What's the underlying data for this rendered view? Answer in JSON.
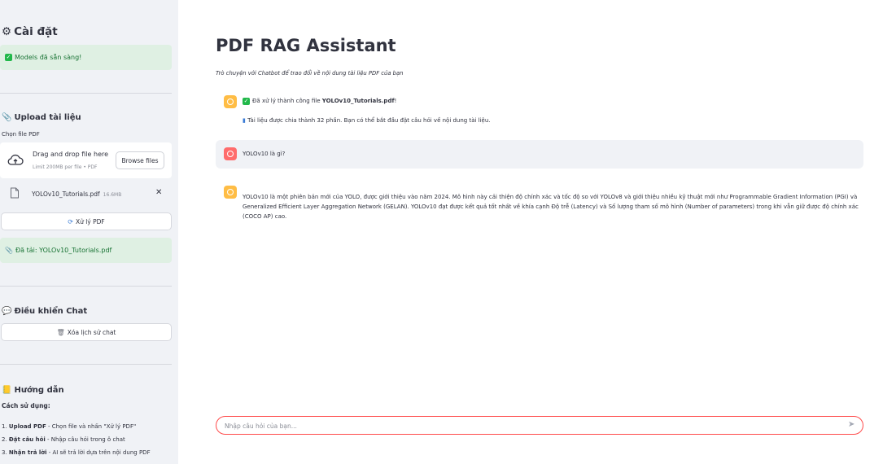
{
  "sidebar": {
    "settings_title": "Cài đặt",
    "models_status": "Models đã sẵn sàng!",
    "upload_title": "Upload tài liệu",
    "file_label": "Chọn file PDF",
    "dropzone_title": "Drag and drop file here",
    "dropzone_limit": "Limit 200MB per file • PDF",
    "browse_label": "Browse files",
    "file_name": "YOLOv10_Tutorials.pdf",
    "file_size": "16.6MB",
    "process_button": "Xử lý PDF",
    "loaded_status": "Đã tải: YOLOv10_Tutorials.pdf",
    "chat_control_title": "Điều khiển Chat",
    "clear_button": "Xóa lịch sử chat",
    "guide_title": "Hướng dẫn",
    "guide_usage": "Cách sử dụng:",
    "guide_steps": [
      {
        "num": "1.",
        "bold": "Upload PDF",
        "text": " - Chọn file và nhấn \"Xử lý PDF\""
      },
      {
        "num": "2.",
        "bold": "Đặt câu hỏi",
        "text": " - Nhập câu hỏi trong ô chat"
      },
      {
        "num": "3.",
        "bold": "Nhận trả lời",
        "text": " - AI sẽ trả lời dựa trên nội dung PDF"
      }
    ]
  },
  "main": {
    "title": "PDF RAG Assistant",
    "caption": "Trò chuyện với Chatbot để trao đổi về nội dung tài liệu PDF của bạn",
    "messages": [
      {
        "role": "assistant",
        "line1_prefix": "Đã xử lý thành công file ",
        "line1_file": "YOLOv10_Tutorials.pdf",
        "line1_suffix": "!",
        "line2": "Tài liệu được chia thành 32 phần. Bạn có thể bắt đầu đặt câu hỏi về nội dung tài liệu."
      },
      {
        "role": "user",
        "text": "YOLOv10 là gì?"
      },
      {
        "role": "assistant",
        "text": "YOLOv10 là một phiên bản mới của YOLO, được giới thiệu vào năm 2024. Mô hình này cải thiện độ chính xác và tốc độ so với YOLOv8 và giới thiệu nhiều kỹ thuật mới như Programmable Gradient Information (PGI) và Generalized Efficient Layer Aggregation Network (GELAN). YOLOv10 đạt được kết quả tốt nhất về khía cạnh Độ trễ (Latency) và Số lượng tham số mô hình (Number of parameters) trong khi vẫn giữ được độ chính xác (COCO AP) cao."
      }
    ],
    "chat_placeholder": "Nhập câu hỏi của bạn..."
  },
  "colors": {
    "sidebar_bg": "#f0f2f6",
    "success_bg": "#dff0e3",
    "success_text": "#177233",
    "accent": "#ff4b4b",
    "assistant_avatar": "#ffbd45",
    "user_avatar": "#ff6c6c"
  },
  "icons": [
    "gear-icon",
    "check-icon",
    "paperclip-icon",
    "cloud-upload-icon",
    "file-icon",
    "close-icon",
    "refresh-icon",
    "chat-icon",
    "trash-icon",
    "book-icon",
    "chart-icon",
    "send-icon"
  ]
}
